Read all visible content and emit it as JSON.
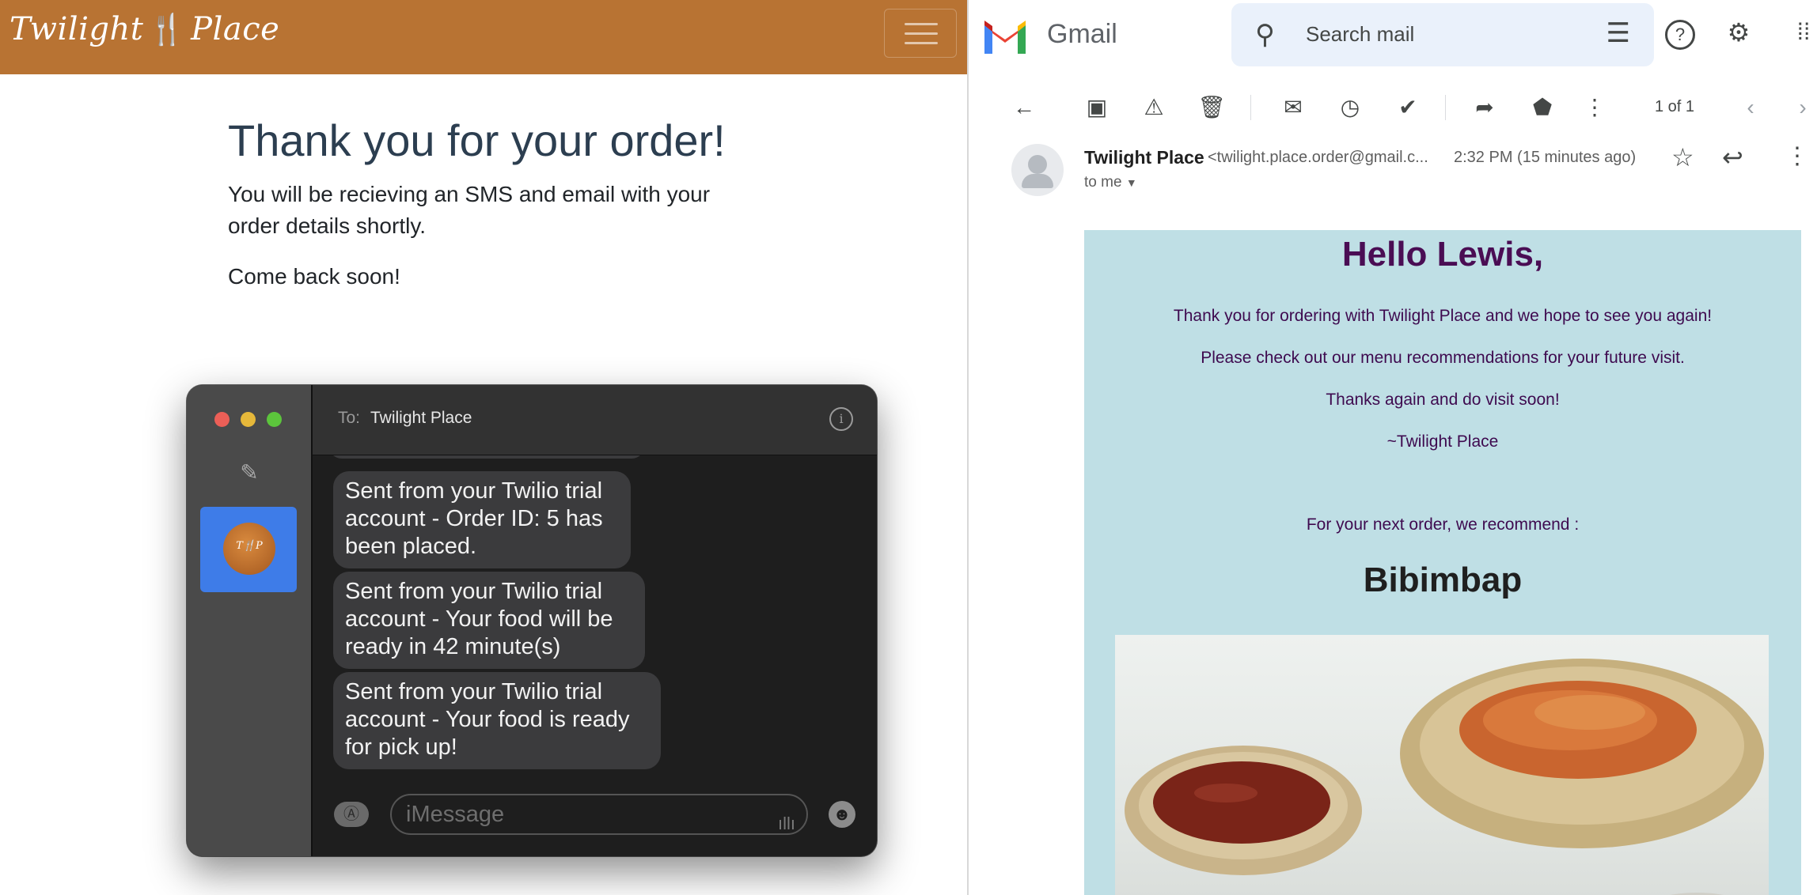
{
  "site": {
    "brand": [
      "Twilight",
      "Place"
    ],
    "thanks_title": "Thank you for your order!",
    "thanks_body": "You will be recieving an SMS and email with your order details shortly.",
    "come_back": "Come back soon!"
  },
  "imessage": {
    "to_label": "To:",
    "to_name": "Twilight Place",
    "messages": [
      "Sent from your Twilio trial account - Order ID: 5 has been placed.",
      "Sent from your Twilio trial account - Your food will be ready in 42 minute(s)",
      "Sent from your Twilio trial account - Your food is ready for pick up!"
    ],
    "input_placeholder": "iMessage"
  },
  "gmail": {
    "app_name": "Gmail",
    "search_placeholder": "Search mail",
    "page_count": "1 of 1",
    "sender_name": "Twilight Place",
    "sender_email": "<twilight.place.order@gmail.c...",
    "time": "2:32 PM (15 minutes ago)",
    "to_me": "to me",
    "body": {
      "greeting": "Hello Lewis,",
      "line1": "Thank you for ordering with Twilight Place and we hope to see you again!",
      "line2": "Please check out our menu recommendations for your future visit.",
      "line3": "Thanks again and do visit soon!",
      "line4": "~Twilight Place",
      "recommend": "For your next order, we recommend :",
      "dish": "Bibimbap"
    }
  },
  "colors": {
    "navbar": "#b87333",
    "email_bg": "#bfdfe5",
    "email_text": "#3e0a4f",
    "imessage_selected": "#3e7ce8"
  }
}
